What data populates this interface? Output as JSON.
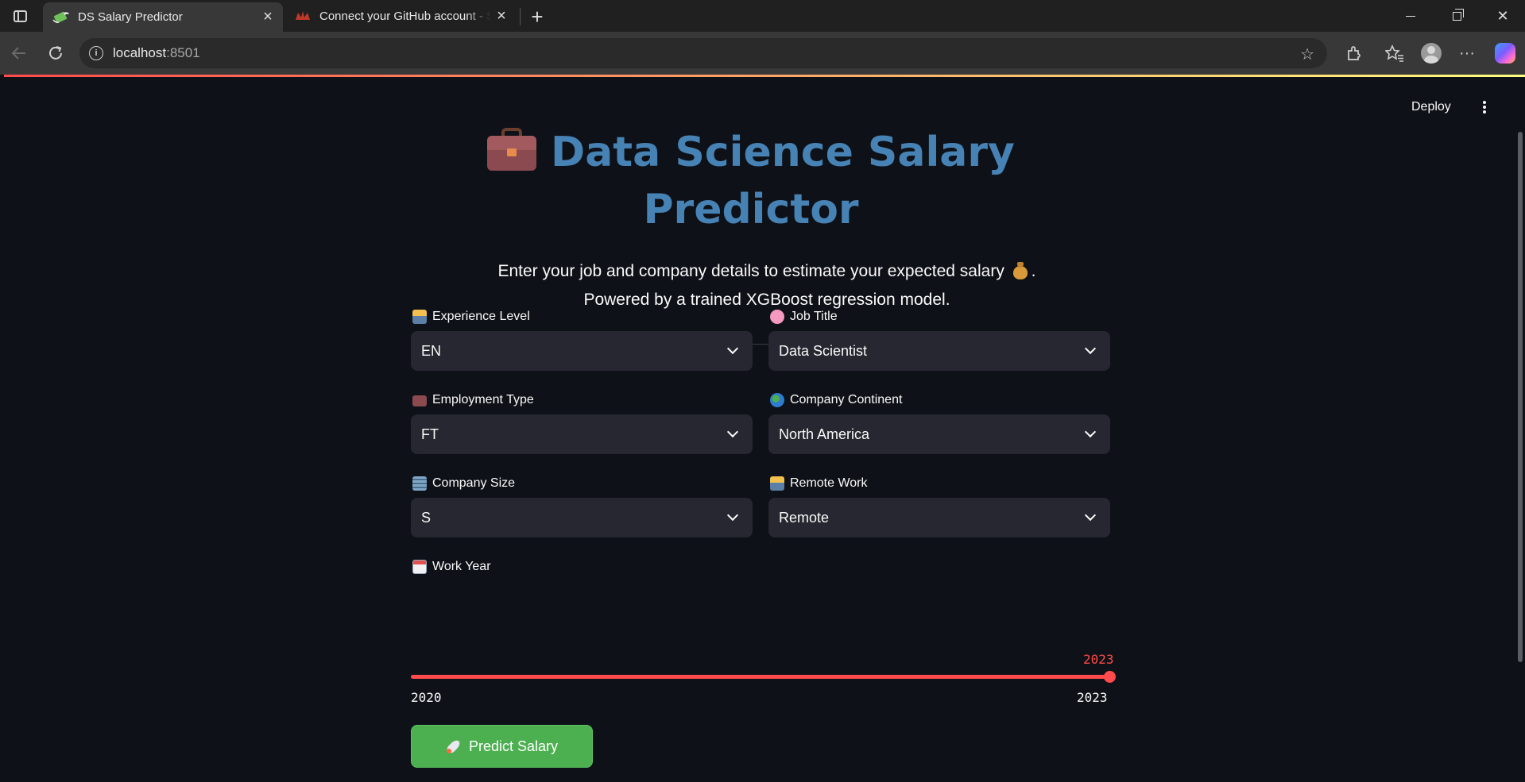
{
  "browser": {
    "tabs": [
      {
        "title": "DS Salary Predictor",
        "active": true,
        "favicon": "money-with-wings-icon"
      },
      {
        "title": "Connect your GitHub account - St",
        "active": false,
        "favicon": "streamlit-crown-icon"
      }
    ],
    "url_host": "localhost",
    "url_port": ":8501"
  },
  "app": {
    "header": {
      "deploy_label": "Deploy",
      "menu_icon": "kebab-menu-icon"
    },
    "title": "Data Science Salary Predictor",
    "title_icon": "briefcase-icon",
    "subtitle_line1": "Enter your job and company details to estimate your expected salary",
    "subtitle_line1_end": ".",
    "subtitle_icon": "money-bag-icon",
    "subtitle_line2": "Powered by a trained XGBoost regression model.",
    "fields": {
      "experience_level": {
        "label": "Experience Level",
        "value": "EN",
        "icon": "technologist-icon"
      },
      "job_title": {
        "label": "Job Title",
        "value": "Data Scientist",
        "icon": "brain-icon"
      },
      "employment_type": {
        "label": "Employment Type",
        "value": "FT",
        "icon": "briefcase-icon"
      },
      "company_continent": {
        "label": "Company Continent",
        "value": "North America",
        "icon": "globe-icon"
      },
      "company_size": {
        "label": "Company Size",
        "value": "S",
        "icon": "office-building-icon"
      },
      "remote_work": {
        "label": "Remote Work",
        "value": "Remote",
        "icon": "technologist-icon"
      }
    },
    "work_year": {
      "label": "Work Year",
      "icon": "calendar-icon",
      "value": "2023",
      "min": "2020",
      "max": "2023",
      "fraction": 1.0
    },
    "predict_button": {
      "label": "Predict Salary",
      "icon": "rocket-icon"
    },
    "colors": {
      "accent": "#ff4b4b",
      "title": "#4682b4",
      "button": "#4caf50",
      "background": "#0e1117",
      "select_bg": "#262730"
    }
  }
}
